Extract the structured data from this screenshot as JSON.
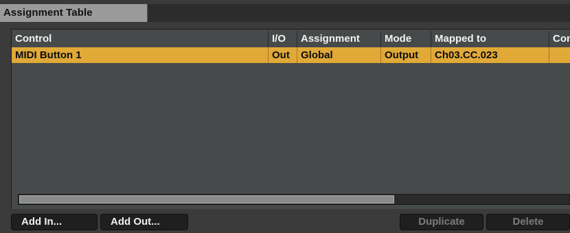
{
  "panel": {
    "title": "Assignment Table"
  },
  "table": {
    "columns": [
      "Control",
      "I/O",
      "Assignment",
      "Mode",
      "Mapped to",
      "Cond"
    ],
    "rows": [
      {
        "control": "MIDI Button 1",
        "io": "Out",
        "assignment": "Global",
        "mode": "Output",
        "mapped_to": "Ch03.CC.023",
        "cond": "",
        "selected": true
      }
    ]
  },
  "buttons": {
    "add_in": "Add In...",
    "add_out": "Add Out...",
    "duplicate": "Duplicate",
    "delete": "Delete"
  },
  "colors": {
    "selected_row": "#e0a938",
    "background": "#464a4a"
  }
}
